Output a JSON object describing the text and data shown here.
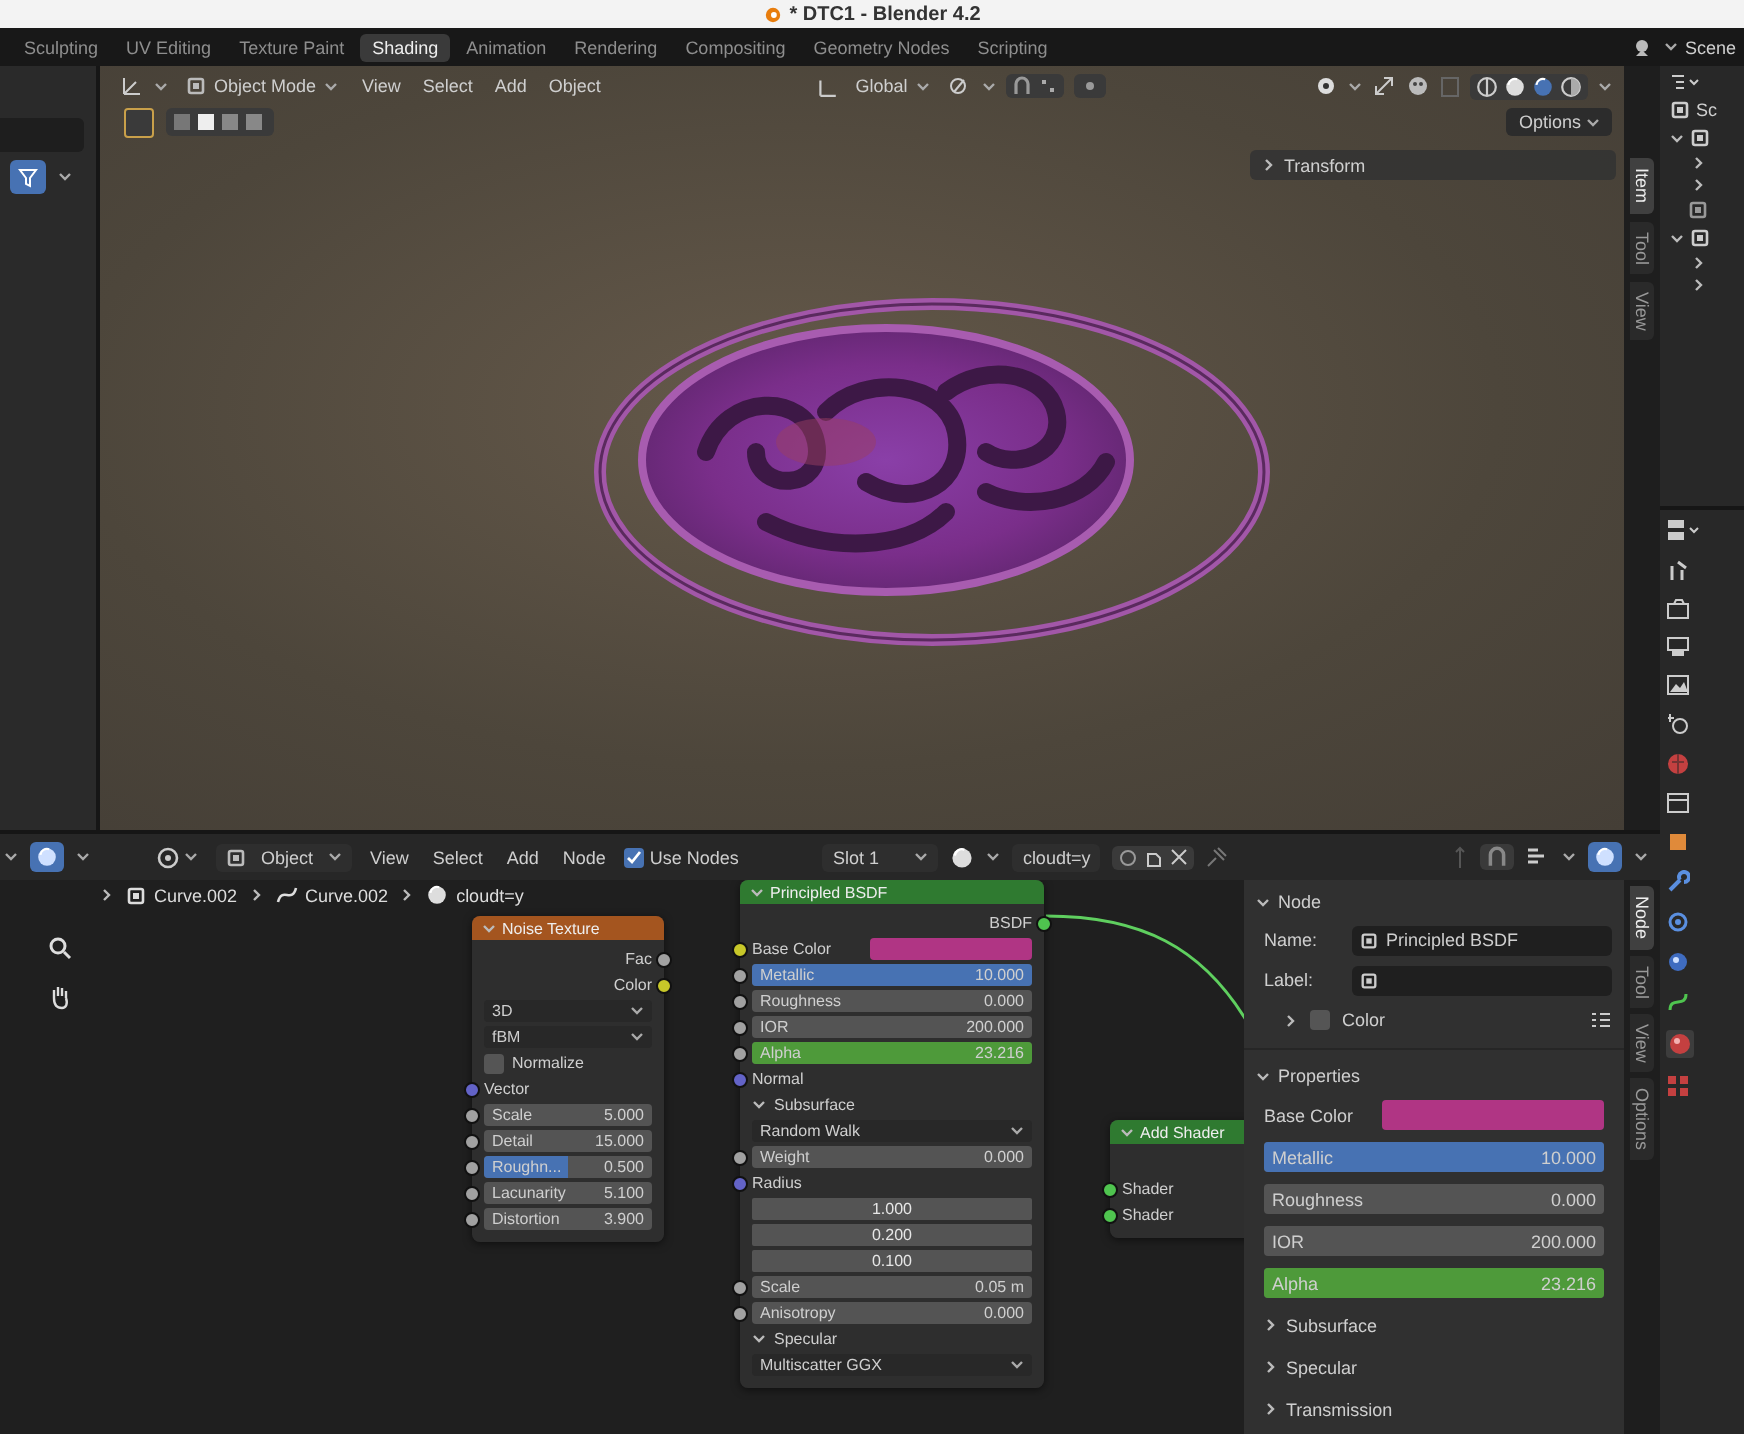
{
  "window": {
    "title": "* DTC1 - Blender 4.2"
  },
  "workspace_tabs": [
    {
      "label": "Sculpting",
      "selected": false
    },
    {
      "label": "UV Editing",
      "selected": false
    },
    {
      "label": "Texture Paint",
      "selected": false
    },
    {
      "label": "Shading",
      "selected": true
    },
    {
      "label": "Animation",
      "selected": false
    },
    {
      "label": "Rendering",
      "selected": false
    },
    {
      "label": "Compositing",
      "selected": false
    },
    {
      "label": "Geometry Nodes",
      "selected": false
    },
    {
      "label": "Scripting",
      "selected": false
    }
  ],
  "scene": {
    "label": "Scene"
  },
  "viewport": {
    "mode": "Object Mode",
    "menus": [
      "View",
      "Select",
      "Add",
      "Object"
    ],
    "orientation": "Global",
    "options": "Options",
    "transform_panel": {
      "title": "Transform",
      "expanded": false
    },
    "tabs": [
      {
        "label": "Item",
        "selected": true
      },
      {
        "label": "Tool",
        "selected": false
      },
      {
        "label": "View",
        "selected": false
      }
    ]
  },
  "node_editor": {
    "editor_mode": "Object",
    "menus": [
      "View",
      "Select",
      "Add",
      "Node"
    ],
    "use_nodes": {
      "label": "Use Nodes",
      "checked": true
    },
    "slot": "Slot 1",
    "material": "cloudt=y",
    "breadcrumbs": [
      "Curve.002",
      "Curve.002",
      "cloudt=y"
    ],
    "nodes": [
      {
        "title": "Noise Texture",
        "kind": "texture",
        "rows": [
          {
            "kind": "output",
            "label": "Fac",
            "socket": {
              "color": "#a1a1a1"
            }
          },
          {
            "kind": "output",
            "label": "Color",
            "socket": {
              "color": "#c7c729"
            }
          },
          {
            "kind": "dropdown",
            "value": "3D"
          },
          {
            "kind": "dropdown",
            "value": "fBM"
          },
          {
            "kind": "checkbox",
            "label": "Normalize",
            "checked": false
          },
          {
            "kind": "label",
            "label": "Vector",
            "socket": {
              "color": "#6363c7"
            }
          },
          {
            "kind": "slider",
            "label": "Scale",
            "value": "5.000",
            "socket": {
              "color": "#a1a1a1"
            }
          },
          {
            "kind": "slider",
            "label": "Detail",
            "value": "15.000",
            "socket": {
              "color": "#a1a1a1"
            }
          },
          {
            "kind": "slider",
            "label": "Roughn...",
            "value": "0.500",
            "level": 0.5,
            "color": "#4772b3",
            "socket": {
              "color": "#a1a1a1"
            }
          },
          {
            "kind": "slider",
            "label": "Lacunarity",
            "value": "5.100",
            "socket": {
              "color": "#a1a1a1"
            }
          },
          {
            "kind": "slider",
            "label": "Distortion",
            "value": "3.900",
            "socket": {
              "color": "#a1a1a1"
            }
          }
        ]
      },
      {
        "title": "Principled BSDF",
        "kind": "shader",
        "rows": [
          {
            "kind": "output",
            "label": "BSDF",
            "socket": {
              "color": "#4fc44f"
            }
          },
          {
            "kind": "color",
            "label": "Base Color",
            "color": "#b03584",
            "socket": {
              "color": "#c7c729"
            }
          },
          {
            "kind": "slider",
            "label": "Metallic",
            "value": "10.000",
            "level": 1,
            "color": "#4772b3",
            "socket": {
              "color": "#a1a1a1"
            }
          },
          {
            "kind": "slider",
            "label": "Roughness",
            "value": "0.000",
            "socket": {
              "color": "#a1a1a1"
            }
          },
          {
            "kind": "slider",
            "label": "IOR",
            "value": "200.000",
            "socket": {
              "color": "#a1a1a1"
            }
          },
          {
            "kind": "slider",
            "label": "Alpha",
            "value": "23.216",
            "level": 1,
            "color": "#4e9a3a",
            "socket": {
              "color": "#a1a1a1"
            }
          },
          {
            "kind": "label",
            "label": "Normal",
            "socket": {
              "color": "#6363c7"
            }
          },
          {
            "kind": "section",
            "label": "Subsurface",
            "expanded": true
          },
          {
            "kind": "dropdown",
            "value": "Random Walk"
          },
          {
            "kind": "slider",
            "label": "Weight",
            "value": "0.000",
            "socket": {
              "color": "#a1a1a1"
            }
          },
          {
            "kind": "label",
            "label": "Radius",
            "socket": {
              "color": "#6363c7"
            }
          },
          {
            "kind": "number",
            "value": "1.000"
          },
          {
            "kind": "number",
            "value": "0.200"
          },
          {
            "kind": "number",
            "value": "0.100"
          },
          {
            "kind": "slider",
            "label": "Scale",
            "value": "0.05 m",
            "socket": {
              "color": "#a1a1a1"
            }
          },
          {
            "kind": "slider",
            "label": "Anisotropy",
            "value": "0.000",
            "socket": {
              "color": "#a1a1a1"
            }
          },
          {
            "kind": "section",
            "label": "Specular",
            "expanded": true
          },
          {
            "kind": "dropdown",
            "value": "Multiscatter GGX"
          }
        ]
      },
      {
        "title": "Add Shader",
        "kind": "shader",
        "rows": [
          {
            "kind": "label",
            "label": "Shader",
            "socket": {
              "color": "#4fc44f"
            }
          },
          {
            "kind": "label",
            "label": "Shader",
            "socket": {
              "color": "#4fc44f"
            }
          }
        ]
      }
    ],
    "sidebar": {
      "tabs": [
        {
          "label": "Node",
          "selected": true
        },
        {
          "label": "Tool",
          "selected": false
        },
        {
          "label": "View",
          "selected": false
        },
        {
          "label": "Options",
          "selected": false
        }
      ],
      "node_panel": {
        "title": "Node",
        "expanded": true,
        "name_label": "Name:",
        "name": "Principled BSDF",
        "label_label": "Label:",
        "color": {
          "label": "Color",
          "expanded": false,
          "checked": false
        }
      },
      "properties_panel": {
        "title": "Properties",
        "expanded": true,
        "rows": [
          {
            "kind": "color",
            "label": "Base Color",
            "color": "#b03584"
          },
          {
            "kind": "slider",
            "label": "Metallic",
            "value": "10.000",
            "level": 1,
            "color": "#4772b3"
          },
          {
            "kind": "slider",
            "label": "Roughness",
            "value": "0.000"
          },
          {
            "kind": "slider",
            "label": "IOR",
            "value": "200.000"
          },
          {
            "kind": "slider",
            "label": "Alpha",
            "value": "23.216",
            "level": 1,
            "color": "#4e9a3a"
          },
          {
            "kind": "section",
            "label": "Subsurface",
            "expanded": false
          },
          {
            "kind": "section",
            "label": "Specular",
            "expanded": false
          },
          {
            "kind": "section",
            "label": "Transmission",
            "expanded": false
          }
        ]
      }
    }
  },
  "outliner": {
    "rows": [
      "Sc"
    ]
  }
}
